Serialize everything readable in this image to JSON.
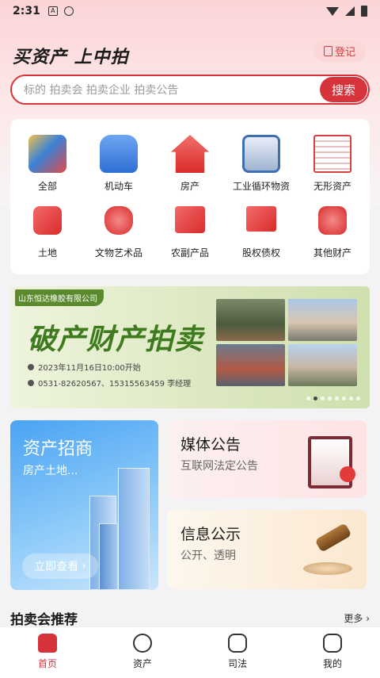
{
  "status_bar": {
    "time": "2:31"
  },
  "header": {
    "app_title": "买资产 上中拍",
    "login_label": "登记"
  },
  "search": {
    "placeholder": "标的 拍卖会 拍卖企业 拍卖公告",
    "button_label": "搜索"
  },
  "categories": [
    {
      "label": "全部",
      "icon": "all-icon",
      "color": "#4a90e2"
    },
    {
      "label": "机动车",
      "icon": "car-icon",
      "color": "#2f6fd6"
    },
    {
      "label": "房产",
      "icon": "house-icon",
      "color": "#e03a3a"
    },
    {
      "label": "工业循环物资",
      "icon": "industrial-icon",
      "color": "#3f6fb3"
    },
    {
      "label": "无形资产",
      "icon": "document-icon",
      "color": "#d94040"
    },
    {
      "label": "土地",
      "icon": "land-icon",
      "color": "#e23b3b"
    },
    {
      "label": "文物艺术品",
      "icon": "vase-icon",
      "color": "#e23b3b"
    },
    {
      "label": "农副产品",
      "icon": "crop-icon",
      "color": "#e23b3b"
    },
    {
      "label": "股权债权",
      "icon": "equity-icon",
      "color": "#e23b3b"
    },
    {
      "label": "其他财产",
      "icon": "money-bag-icon",
      "color": "#e23b3b"
    }
  ],
  "banner": {
    "company": "山东恒达橡胶有限公司",
    "title": "破产财产拍卖",
    "date_line": "2023年11月16日10:00开始",
    "contact_line": "0531-82620567、15315563459 李经理"
  },
  "tiles": {
    "invest": {
      "title": "资产招商",
      "subtitle": "房产土地...",
      "button": "立即查看"
    },
    "media": {
      "title": "媒体公告",
      "subtitle": "互联网法定公告"
    },
    "info": {
      "title": "信息公示",
      "subtitle": "公开、透明"
    }
  },
  "section": {
    "title": "拍卖会推荐",
    "more": "更多"
  },
  "tabbar": [
    {
      "label": "首页",
      "icon": "home-icon",
      "active": true
    },
    {
      "label": "资产",
      "icon": "asset-icon",
      "active": false
    },
    {
      "label": "司法",
      "icon": "justice-icon",
      "active": false
    },
    {
      "label": "我的",
      "icon": "user-icon",
      "active": false
    }
  ],
  "colors": {
    "brand_red": "#d6343a",
    "banner_green": "#3e7a1e"
  }
}
